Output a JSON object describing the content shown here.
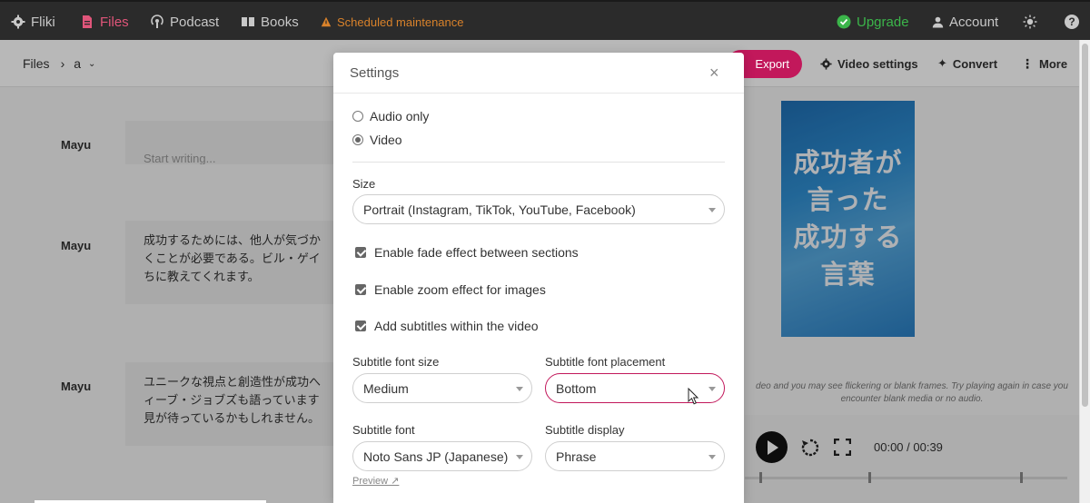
{
  "nav": {
    "brand": "Fliki",
    "files": "Files",
    "podcast": "Podcast",
    "books": "Books",
    "maintenance": "Scheduled maintenance",
    "upgrade": "Upgrade",
    "account": "Account",
    "help": "?"
  },
  "toolbar": {
    "breadcrumb_root": "Files",
    "breadcrumb_sep": "›",
    "breadcrumb_current": "a",
    "export": "Export",
    "video_settings": "Video settings",
    "convert": "Convert",
    "more": "More"
  },
  "editor": {
    "blocks": [
      {
        "speaker": "Mayu",
        "text": "",
        "placeholder": "Start writing..."
      },
      {
        "speaker": "Mayu",
        "text": "成功するためには、他人が気づか\nくことが必要である。ビル・ゲイ\nちに教えてくれます。"
      },
      {
        "speaker": "Mayu",
        "text": "ユニークな視点と創造性が成功へ\nィーブ・ジョブズも語っています\n見が待っているかもしれません。"
      }
    ]
  },
  "preview": {
    "thumbnail_text": "成功者が\n言った\n成功する\n言葉",
    "warning": "deo and you may see flickering or blank frames. Try playing again in case you\nencounter blank media or no audio.",
    "time": "00:00 / 00:39"
  },
  "modal": {
    "title": "Settings",
    "close": "×",
    "audio_only": "Audio only",
    "video": "Video",
    "selected_mode": "Video",
    "size_label": "Size",
    "size_value": "Portrait (Instagram, TikTok, YouTube, Facebook)",
    "fade_label": "Enable fade effect between sections",
    "zoom_label": "Enable zoom effect for images",
    "subtitles_label": "Add subtitles within the video",
    "font_size_label": "Subtitle font size",
    "font_size_value": "Medium",
    "placement_label": "Subtitle font placement",
    "placement_value": "Bottom",
    "font_label": "Subtitle font",
    "font_value": "Noto Sans JP (Japanese)",
    "display_label": "Subtitle display",
    "display_value": "Phrase",
    "preview_link": "Preview ↗"
  },
  "colors": {
    "accent": "#c2185b",
    "upgrade": "#3bb54a",
    "maintenance": "#d9822b",
    "navbar": "#2b2b2b"
  }
}
